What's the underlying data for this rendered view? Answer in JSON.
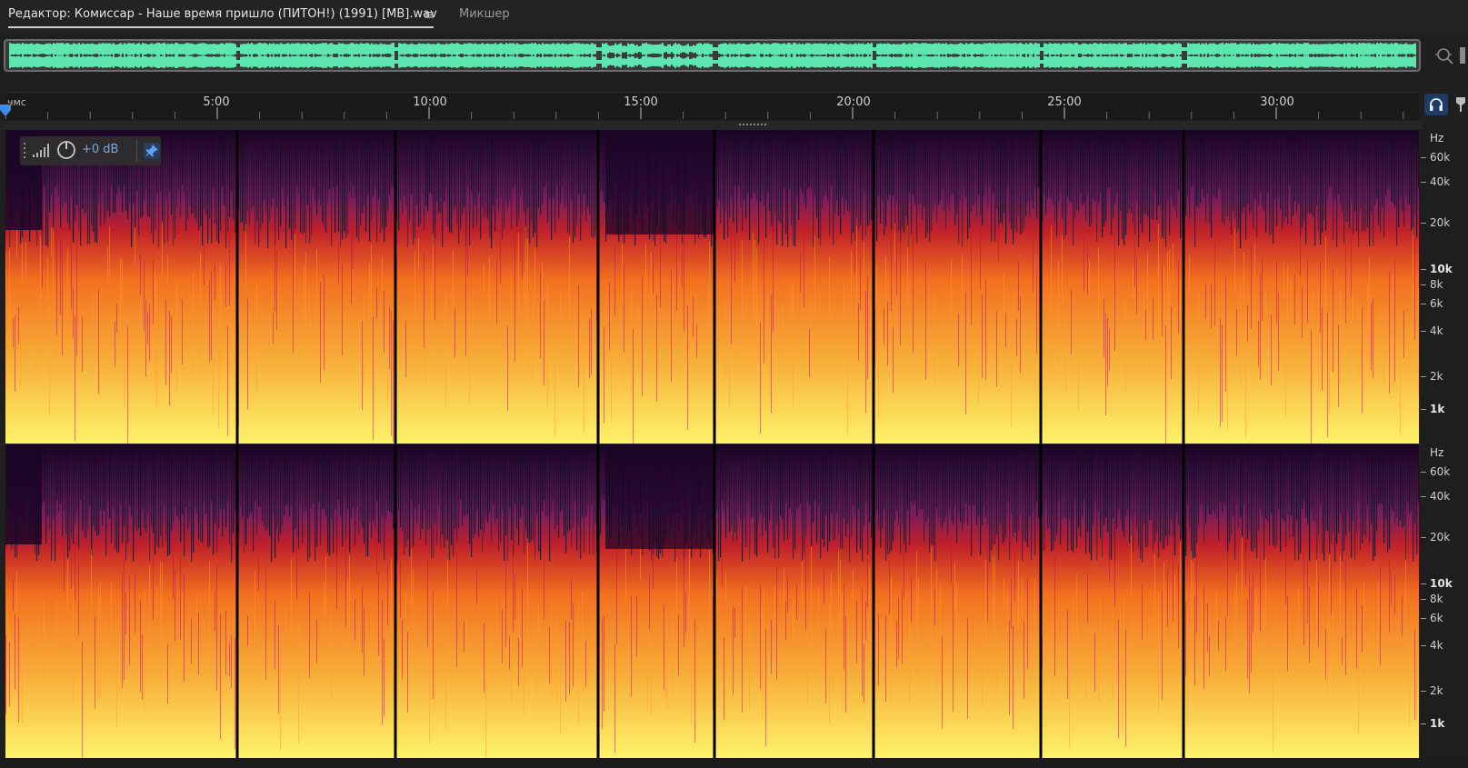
{
  "editor": {
    "tab_label": "Редактор: Комиссар - Наше время пришло (ПИТОН!) (1991) [MB].wav",
    "menu_glyph": "≡",
    "mixer_label": "Микшер"
  },
  "ruler": {
    "unit": "чмс",
    "ticks": [
      "5:00",
      "10:00",
      "15:00",
      "20:00",
      "25:00",
      "30:00"
    ]
  },
  "hud": {
    "gain": "+0 dB"
  },
  "frequency_axis": {
    "title": "Hz",
    "labels": [
      "60k",
      "40k",
      "20k",
      "10k",
      "8k",
      "6k",
      "4k",
      "2k",
      "1k"
    ],
    "strong": [
      "10k",
      "1k"
    ]
  },
  "colors": {
    "waveform": "#5ee6b0",
    "accent": "#3b8ef0",
    "spectrum_low": "#fdf36a",
    "spectrum_mid": "#f2711f",
    "spectrum_high": "#7a1d5c",
    "spectrum_top": "#1a0626"
  },
  "icons": {
    "menu": "menu-icon",
    "zoom": "zoom-fit-icon",
    "headphones": "headphones-icon",
    "marker": "marker-icon",
    "level": "level-meter-icon",
    "knob": "gain-knob-icon",
    "pin": "pin-icon"
  }
}
